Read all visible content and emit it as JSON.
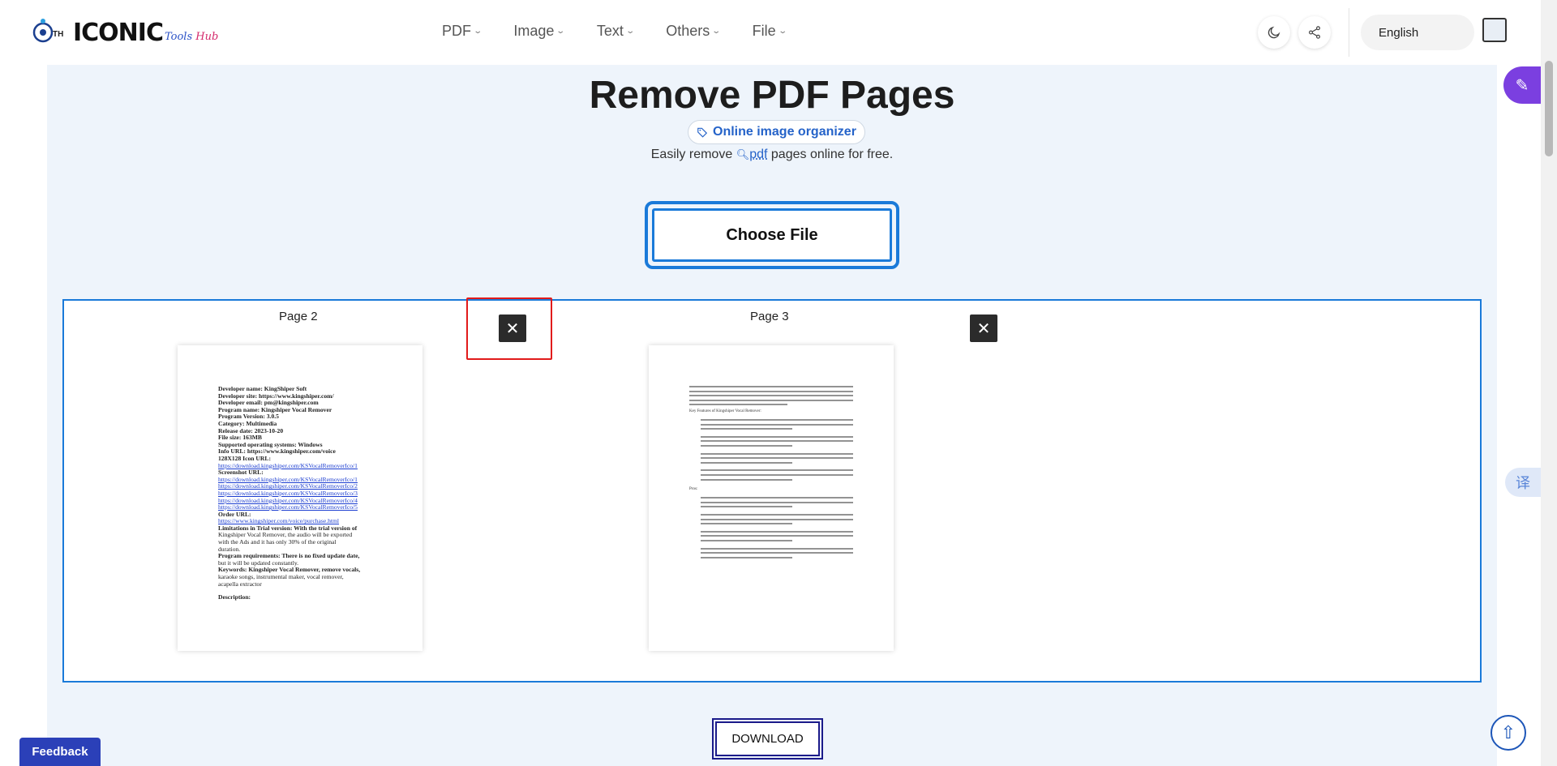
{
  "brand": {
    "logo_prefix": "ITH",
    "logo_word": "ICONIC",
    "logo_sub_1": "Tools",
    "logo_sub_2": "Hub"
  },
  "nav": [
    {
      "label": "PDF"
    },
    {
      "label": "Image"
    },
    {
      "label": "Text"
    },
    {
      "label": "Others"
    },
    {
      "label": "File"
    }
  ],
  "header": {
    "language": "English"
  },
  "page": {
    "title": "Remove PDF Pages",
    "tag": "Online image organizer",
    "subtitle_before": "Easily remove",
    "subtitle_keyword": "pdf",
    "subtitle_after": "pages online for free.",
    "choose_file": "Choose File",
    "download": "DOWNLOAD"
  },
  "pages": [
    {
      "label": "Page 2"
    },
    {
      "label": "Page 3"
    }
  ],
  "page2_doc": {
    "lines": [
      "Developer name: KingShiper Soft",
      "Developer site: https://www.kingshiper.com/",
      "Developer email: pm@kingshiper.com",
      "Program name: Kingshiper Vocal Remover",
      "Program Version: 3.0.5",
      "Category: Multimedia",
      "Release date: 2023-10-20",
      "File size: 163MB",
      "Supported operating systems: Windows",
      "Info URL: https://www.kingshiper.com/voice",
      "128X128 Icon URL:",
      "https://download.kingshiper.com/KSVocalRemoverIco/1",
      "Screenshot URL:",
      "https://download.kingshiper.com/KSVocalRemoverIco/1",
      "https://download.kingshiper.com/KSVocalRemoverIco/2",
      "https://download.kingshiper.com/KSVocalRemoverIco/3",
      "https://download.kingshiper.com/KSVocalRemoverIco/4",
      "https://download.kingshiper.com/KSVocalRemoverIco/5",
      "Order URL:",
      "https://www.kingshiper.com/voice/purchase.html",
      "Limitations in Trial version: With the trial version of",
      "Kingshiper Vocal Remover, the audio will be exported",
      "with the Ads and it has only 30% of the original",
      "duration.",
      "Program requirements: There is no fixed update date,",
      "but it will be updated constantly.",
      "Keywords: Kingshiper Vocal Remover, remove vocals,",
      "karaoke songs, instrumental maker, vocal remover,",
      "acapella extractor",
      "Description:"
    ]
  },
  "page3_doc": {
    "heading_1": "Key Features of Kingshiper Vocal Remover:",
    "heading_2": "Pros:"
  },
  "misc": {
    "feedback": "Feedback",
    "translate_icon": "译"
  },
  "icons": {
    "theme": "moon-icon",
    "share": "share-icon",
    "close": "close-icon",
    "back_to_top": "arrow-up-icon",
    "tag": "tag-icon",
    "search": "search-icon"
  },
  "colors": {
    "accent": "#1a7ad9",
    "highlight": "#e11b1b",
    "feedback": "#2b40b8",
    "fab": "#7b3fe0"
  }
}
